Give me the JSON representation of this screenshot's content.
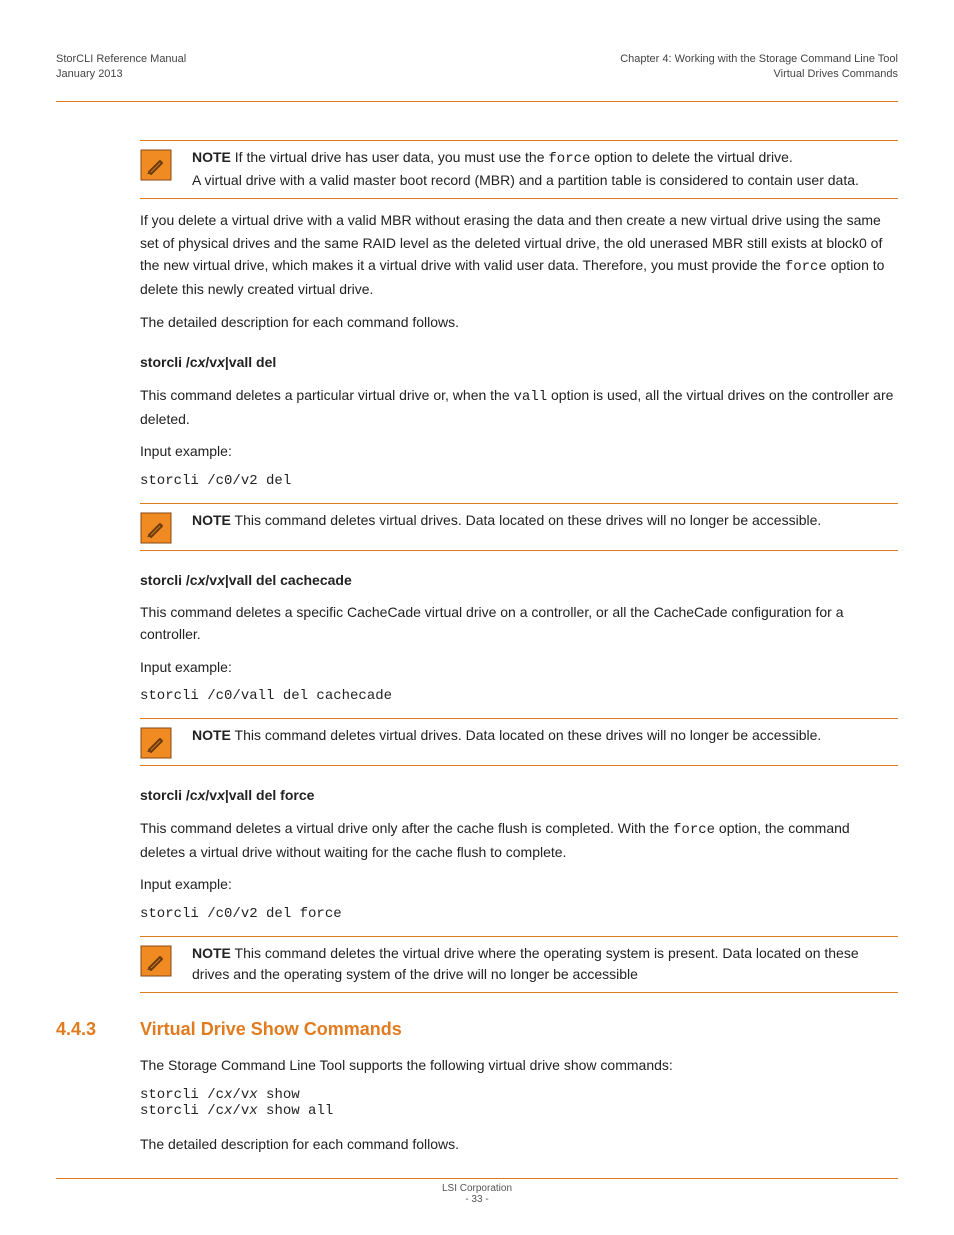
{
  "header": {
    "left_line1": "StorCLI Reference Manual",
    "left_line2": "January 2013",
    "right_line1": "Chapter 4:  Working with the Storage Command Line Tool",
    "right_line2": "Virtual Drives Commands"
  },
  "note1": {
    "lead": "NOTE",
    "sentence_a": "If the virtual drive has user data, you must use the ",
    "code_a": "force",
    "sentence_b": " option to delete the virtual drive.",
    "line2": "A virtual drive with a valid master boot record (MBR) and a partition table is considered to contain user data."
  },
  "para_mbr_a": "If you delete a virtual drive with a valid MBR without erasing the data and then create a new virtual drive using the same set of physical drives and the same RAID level as the deleted virtual drive, the old unerased MBR still exists at block0 of the new virtual drive, which makes it a virtual drive with valid user data. Therefore, you must provide the ",
  "para_mbr_code": "force",
  "para_mbr_b": " option to delete this newly created virtual drive.",
  "detailed_desc": "The detailed description for each command follows.",
  "head1": {
    "pre": "storcli /c",
    "x1": "x",
    "mid": "/v",
    "x2": "x",
    "post": "|vall del"
  },
  "head1_desc_a": "This command deletes a particular virtual drive or, when the ",
  "head1_desc_code": "vall",
  "head1_desc_b": " option is used, all the virtual drives on the controller are deleted.",
  "input_example": "Input example:",
  "cmd1": "storcli /c0/v2 del",
  "note2": {
    "lead": "NOTE",
    "text": "This command deletes virtual drives. Data located on these drives will no longer be accessible."
  },
  "head2": {
    "pre": "storcli /c",
    "x1": "x",
    "mid": "/v",
    "x2": "x",
    "post": "|vall del cachecade"
  },
  "head2_desc": "This command deletes a specific CacheCade virtual drive on a controller, or all the CacheCade configuration for a controller.",
  "cmd2": "storcli /c0/vall del cachecade",
  "note3": {
    "lead": "NOTE",
    "text": "This command deletes virtual drives. Data located on these drives will no longer be accessible."
  },
  "head3": {
    "pre": "storcli /c",
    "x1": "x",
    "mid": "/v",
    "x2": "x",
    "post": "|vall del force"
  },
  "head3_desc_a": "This command deletes a virtual drive only after the cache flush is completed. With the ",
  "head3_desc_code": "force",
  "head3_desc_b": " option, the command deletes a virtual drive without waiting for the cache flush to complete.",
  "cmd3": "storcli /c0/v2 del force",
  "note4": {
    "lead": "NOTE",
    "text": "This command deletes the virtual drive where the operating system is present. Data located on these drives and the operating system of the drive will no longer be accessible"
  },
  "section": {
    "num": "4.4.3",
    "title": "Virtual Drive Show Commands"
  },
  "section_intro": "The Storage Command Line Tool supports the following virtual drive show commands:",
  "cmd4": {
    "l1_a": "storcli /c",
    "l1_x": "x",
    "l1_b": "/v",
    "l1_y": "x",
    "l1_c": " show",
    "l2_a": "storcli /c",
    "l2_x": "x",
    "l2_b": "/v",
    "l2_y": "x",
    "l2_c": " show all"
  },
  "detailed_desc2": "The detailed description for each command follows.",
  "footer": {
    "company": "LSI Corporation",
    "pagenum": "- 33 -"
  }
}
